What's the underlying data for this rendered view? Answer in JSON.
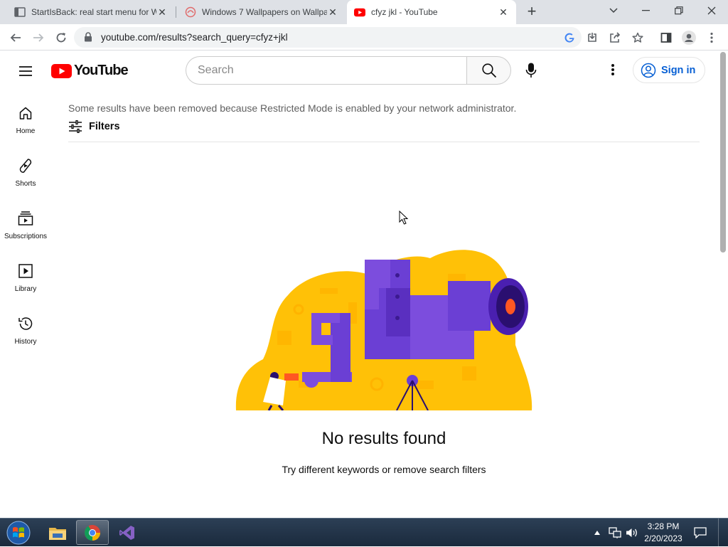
{
  "browser": {
    "tabs": [
      {
        "title": "StartIsBack: real start menu for W",
        "icon": "page-icon",
        "active": false
      },
      {
        "title": "Windows 7 Wallpapers on Wallpa",
        "icon": "wallpaper-icon",
        "active": false
      },
      {
        "title": "cfyz jkl - YouTube",
        "icon": "youtube-icon",
        "active": true
      }
    ],
    "new_tab": "+",
    "url": "youtube.com/results?search_query=cfyz+jkl"
  },
  "youtube": {
    "logo_text": "YouTube",
    "search_placeholder": "Search",
    "search_value": "",
    "signin_label": "Sign in",
    "guide": [
      {
        "label": "Home",
        "icon": "home-icon"
      },
      {
        "label": "Shorts",
        "icon": "shorts-icon"
      },
      {
        "label": "Subscriptions",
        "icon": "subscriptions-icon"
      },
      {
        "label": "Library",
        "icon": "library-icon"
      },
      {
        "label": "History",
        "icon": "history-icon"
      }
    ],
    "restricted_notice": "Some results have been removed because Restricted Mode is enabled by your network administrator.",
    "filters_label": "Filters",
    "no_results_title": "No results found",
    "no_results_hint": "Try different keywords or remove search filters",
    "colors": {
      "brand_red": "#ff0000",
      "link_blue": "#065fd4",
      "illustration_yellow": "#ffc107",
      "illustration_purple": "#6b3fd4"
    }
  },
  "taskbar": {
    "apps": [
      "windows-explorer-icon",
      "chrome-icon",
      "visual-studio-icon"
    ],
    "time": "3:28 PM",
    "date": "2/20/2023"
  }
}
